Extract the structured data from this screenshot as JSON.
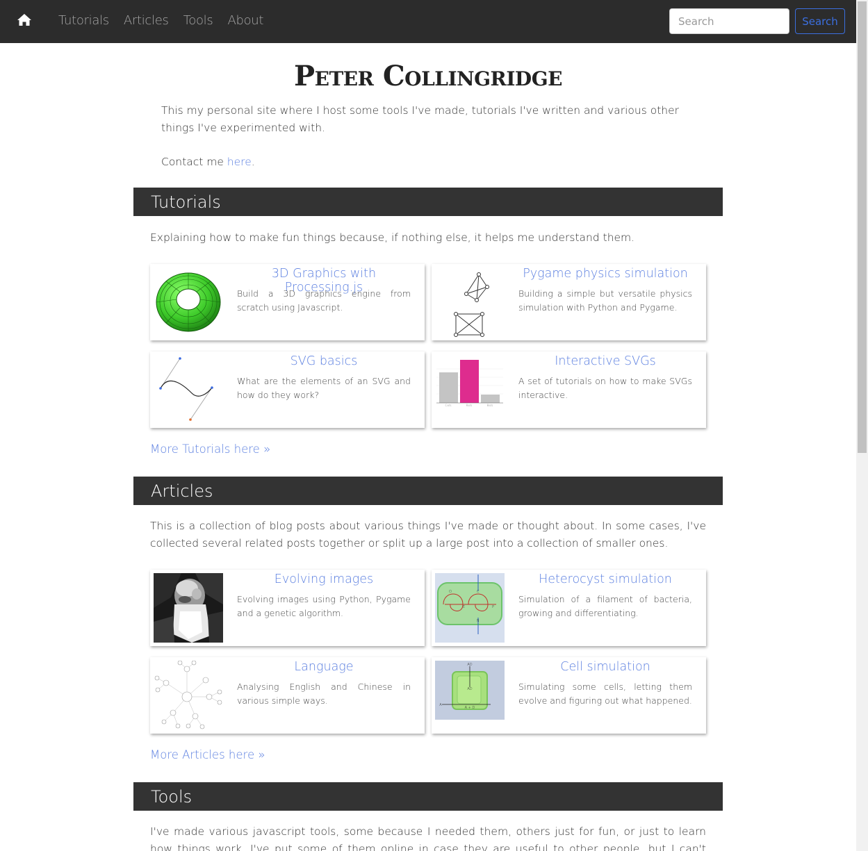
{
  "nav": {
    "home_icon": "home-icon",
    "links": [
      "Tutorials",
      "Articles",
      "Tools",
      "About"
    ],
    "search_placeholder": "Search",
    "search_button": "Search"
  },
  "site": {
    "title": "Peter Collingridge",
    "intro": "This my personal site where I host some tools I've made, tutorials I've written and various other things I've experimented with.",
    "contact_prefix": "Contact me ",
    "contact_link": "here",
    "contact_suffix": "."
  },
  "tutorials": {
    "heading": "Tutorials",
    "description": "Explaining how to make fun things because, if nothing else, it helps me understand them.",
    "cards": [
      {
        "title": "3D Graphics with Processing.js",
        "text": "Build a 3D graphics engine from scratch using Javascript."
      },
      {
        "title": "Pygame physics simulation",
        "text": "Building a simple but versatile physics simulation with Python and Pygame."
      },
      {
        "title": "SVG basics",
        "text": "What are the elements of an SVG and how do they work?"
      },
      {
        "title": "Interactive SVGs",
        "text": "A set of tutorials on how to make SVGs interactive."
      }
    ],
    "more": "More Tutorials here »"
  },
  "articles": {
    "heading": "Articles",
    "description": "This is a collection of blog posts about various things I've made or thought about. In some cases, I've collected several related posts together or split up a large post into a collection of smaller ones.",
    "cards": [
      {
        "title": "Evolving images",
        "text": "Evolving images using Python, Pygame and a genetic algorithm."
      },
      {
        "title": "Heterocyst simulation",
        "text": "Simulation of a filament of bacteria, growing and differentiating."
      },
      {
        "title": "Language",
        "text": "Analysing English and Chinese in various simple ways."
      },
      {
        "title": "Cell simulation",
        "text": "Simulating some cells, letting them evolve and figuring out what happened."
      }
    ],
    "more": "More Articles here »"
  },
  "tools": {
    "heading": "Tools",
    "description": "I've made various javascript tools, some because I needed them, others just for fun, or just to learn how things work. I've put some of them online in case they are useful to other people, but I can't guarantee"
  },
  "thumb_labels": {
    "bar_categories": [
      "Cats",
      "Rats",
      "Bats"
    ],
    "cell_labels": [
      "AD",
      "AD",
      "A",
      "A + D"
    ],
    "heterocyst_labels": [
      "O",
      "C",
      "E",
      "P",
      "N"
    ]
  },
  "colors": {
    "navbar": "#2c2c2c",
    "section_header": "#333333",
    "link": "#5b7fe0",
    "search_button": "#3b6fe0"
  }
}
